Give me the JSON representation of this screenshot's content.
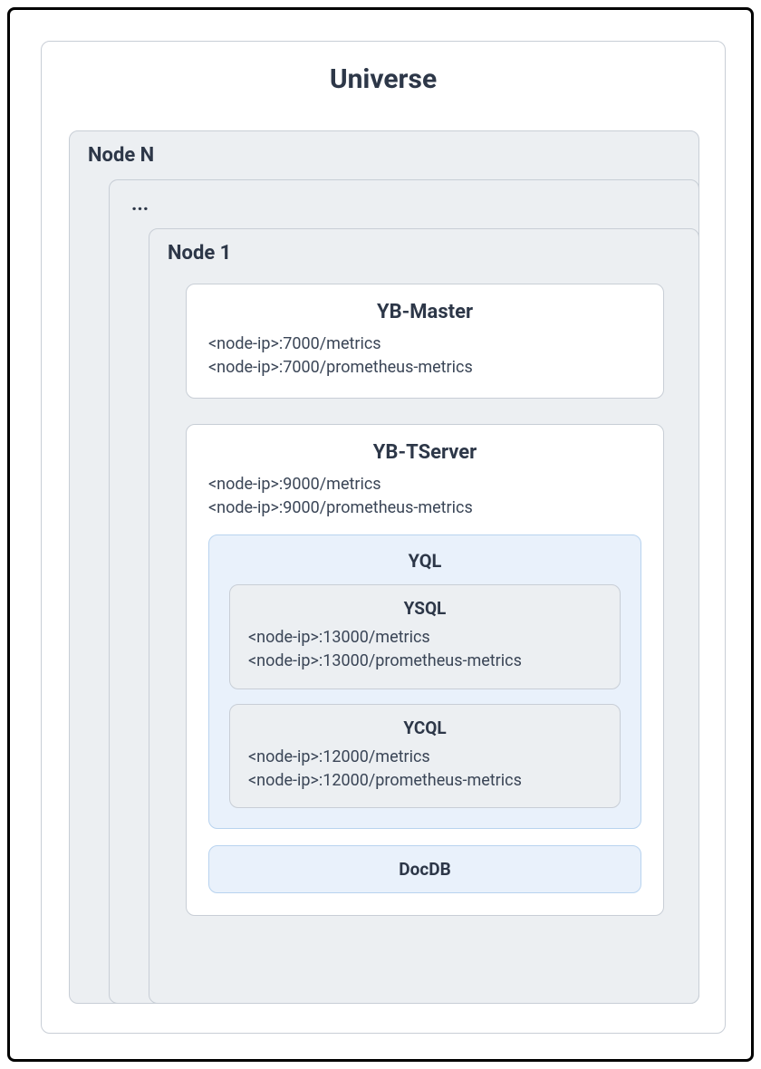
{
  "universe": {
    "title": "Universe"
  },
  "nodes": {
    "back": "Node N",
    "middle": "...",
    "front": "Node 1"
  },
  "ybmaster": {
    "title": "YB-Master",
    "endpoint1": "<node-ip>:7000/metrics",
    "endpoint2": "<node-ip>:7000/prometheus-metrics"
  },
  "ybtserver": {
    "title": "YB-TServer",
    "endpoint1": "<node-ip>:9000/metrics",
    "endpoint2": "<node-ip>:9000/prometheus-metrics",
    "yql": {
      "title": "YQL",
      "ysql": {
        "title": "YSQL",
        "endpoint1": "<node-ip>:13000/metrics",
        "endpoint2": "<node-ip>:13000/prometheus-metrics"
      },
      "ycql": {
        "title": "YCQL",
        "endpoint1": "<node-ip>:12000/metrics",
        "endpoint2": "<node-ip>:12000/prometheus-metrics"
      }
    },
    "docdb": {
      "title": "DocDB"
    }
  }
}
